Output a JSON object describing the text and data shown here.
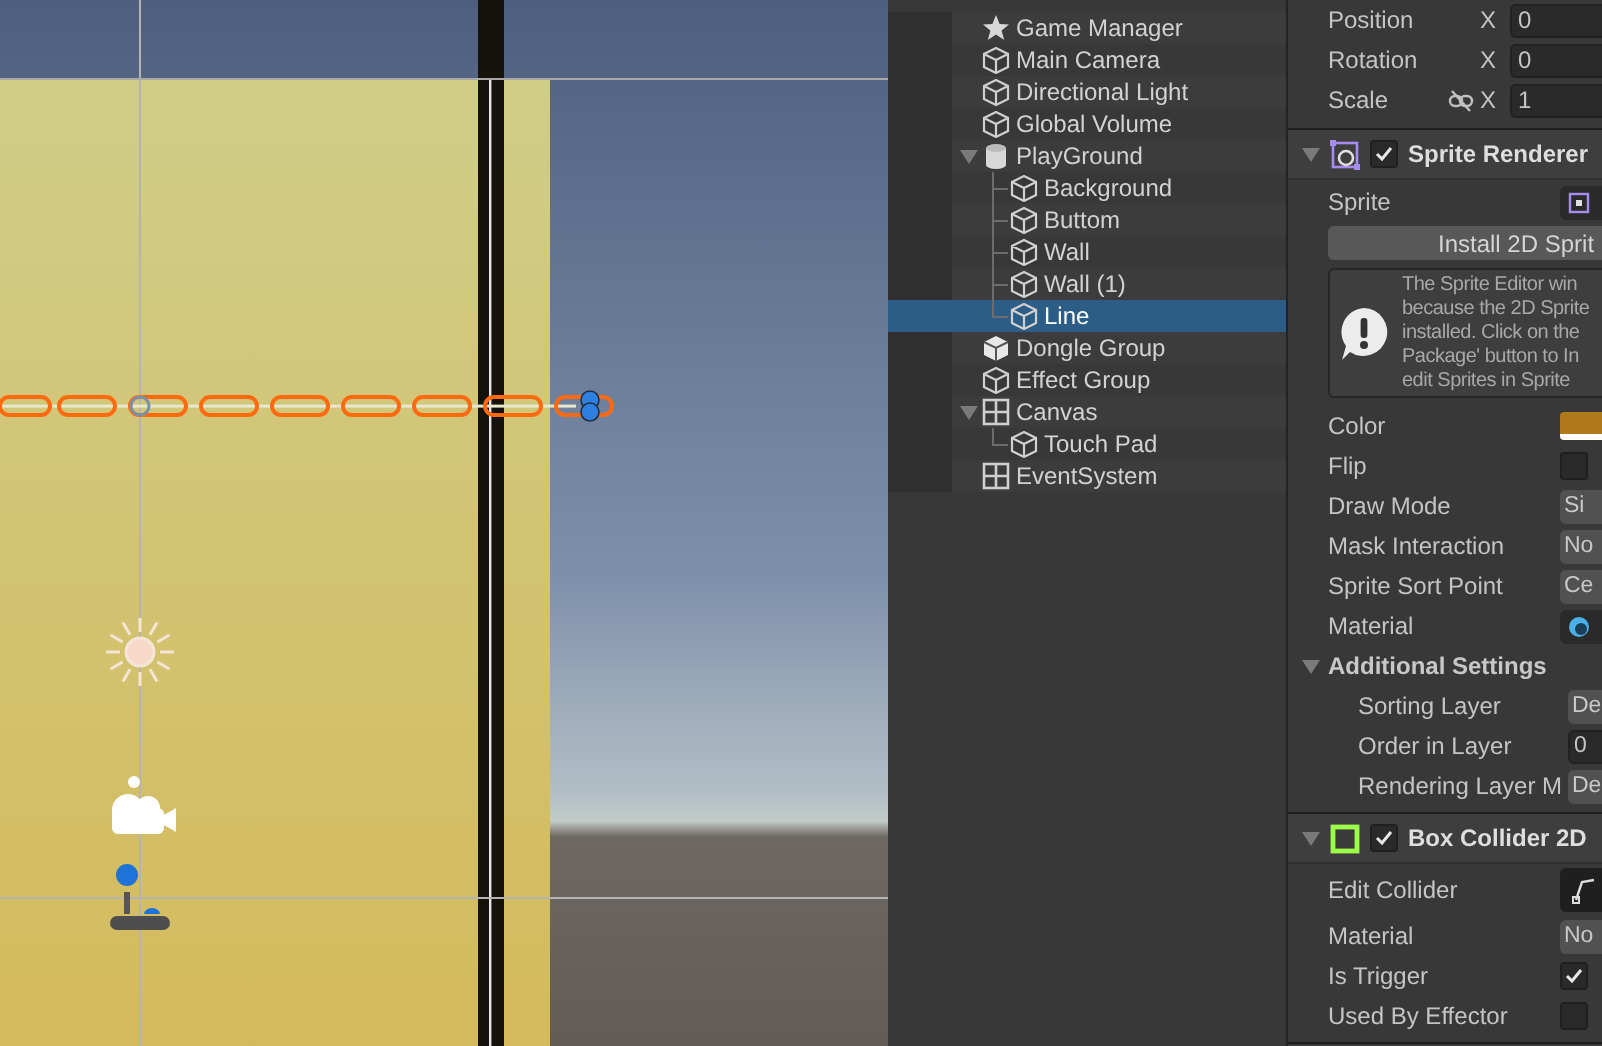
{
  "hierarchy": {
    "items": [
      {
        "label": "Game Manager",
        "kind": "star",
        "selected": false
      },
      {
        "label": "Main Camera",
        "kind": "cube",
        "selected": false
      },
      {
        "label": "Directional Light",
        "kind": "cube",
        "selected": false
      },
      {
        "label": "Global Volume",
        "kind": "cube",
        "selected": false
      },
      {
        "label": "PlayGround",
        "kind": "cylinder",
        "selected": false,
        "expanded": true,
        "children": [
          {
            "label": "Background",
            "kind": "cube",
            "selected": false
          },
          {
            "label": "Buttom",
            "kind": "cube",
            "selected": false
          },
          {
            "label": "Wall",
            "kind": "cube",
            "selected": false
          },
          {
            "label": "Wall (1)",
            "kind": "cube",
            "selected": false
          },
          {
            "label": "Line",
            "kind": "cube",
            "selected": true
          }
        ]
      },
      {
        "label": "Dongle Group",
        "kind": "prefab",
        "selected": false
      },
      {
        "label": "Effect Group",
        "kind": "cube",
        "selected": false
      },
      {
        "label": "Canvas",
        "kind": "grid",
        "selected": false,
        "expanded": true,
        "children": [
          {
            "label": "Touch Pad",
            "kind": "cube",
            "selected": false
          }
        ]
      },
      {
        "label": "EventSystem",
        "kind": "grid",
        "selected": false
      }
    ]
  },
  "inspector": {
    "transform": [
      {
        "label": "Position",
        "axis": "X",
        "value": "0"
      },
      {
        "label": "Rotation",
        "axis": "X",
        "value": "0"
      },
      {
        "label": "Scale",
        "axis": "X",
        "value": "1",
        "proportions_linked": false
      }
    ],
    "components": [
      {
        "title": "Sprite Renderer",
        "kind": "sprite",
        "enabled": true,
        "expanded": true,
        "rows": [
          {
            "kind": "sprite_field",
            "label": "Sprite"
          },
          {
            "kind": "button",
            "text": "Install 2D Sprit"
          },
          {
            "kind": "help",
            "text": "The Sprite Editor win\nbecause the 2D Sprite\ninstalled. Click on the\nPackage' button to In\nedit Sprites in Sprite"
          },
          {
            "kind": "color",
            "label": "Color",
            "color": "#b07a1c"
          },
          {
            "kind": "checkbox",
            "label": "Flip",
            "checked": false
          },
          {
            "kind": "dropdown",
            "label": "Draw Mode",
            "value": "Si"
          },
          {
            "kind": "dropdown",
            "label": "Mask Interaction",
            "value": "No"
          },
          {
            "kind": "dropdown",
            "label": "Sprite Sort Point",
            "value": "Ce"
          },
          {
            "kind": "material_field",
            "label": "Material"
          },
          {
            "kind": "foldout",
            "label": "Additional Settings",
            "expanded": true,
            "children": [
              {
                "kind": "dropdown",
                "label": "Sorting Layer",
                "value": "De"
              },
              {
                "kind": "field",
                "label": "Order in Layer",
                "value": "0"
              },
              {
                "kind": "dropdown",
                "label": "Rendering Layer M",
                "value": "De"
              }
            ]
          }
        ]
      },
      {
        "title": "Box Collider 2D",
        "kind": "collider",
        "enabled": true,
        "expanded": true,
        "rows": [
          {
            "kind": "edit",
            "label": "Edit Collider"
          },
          {
            "kind": "object",
            "label": "Material",
            "value": "No"
          },
          {
            "kind": "checkbox",
            "label": "Is Trigger",
            "checked": true
          },
          {
            "kind": "checkbox",
            "label": "Used By Effector",
            "checked": false
          }
        ]
      }
    ]
  }
}
